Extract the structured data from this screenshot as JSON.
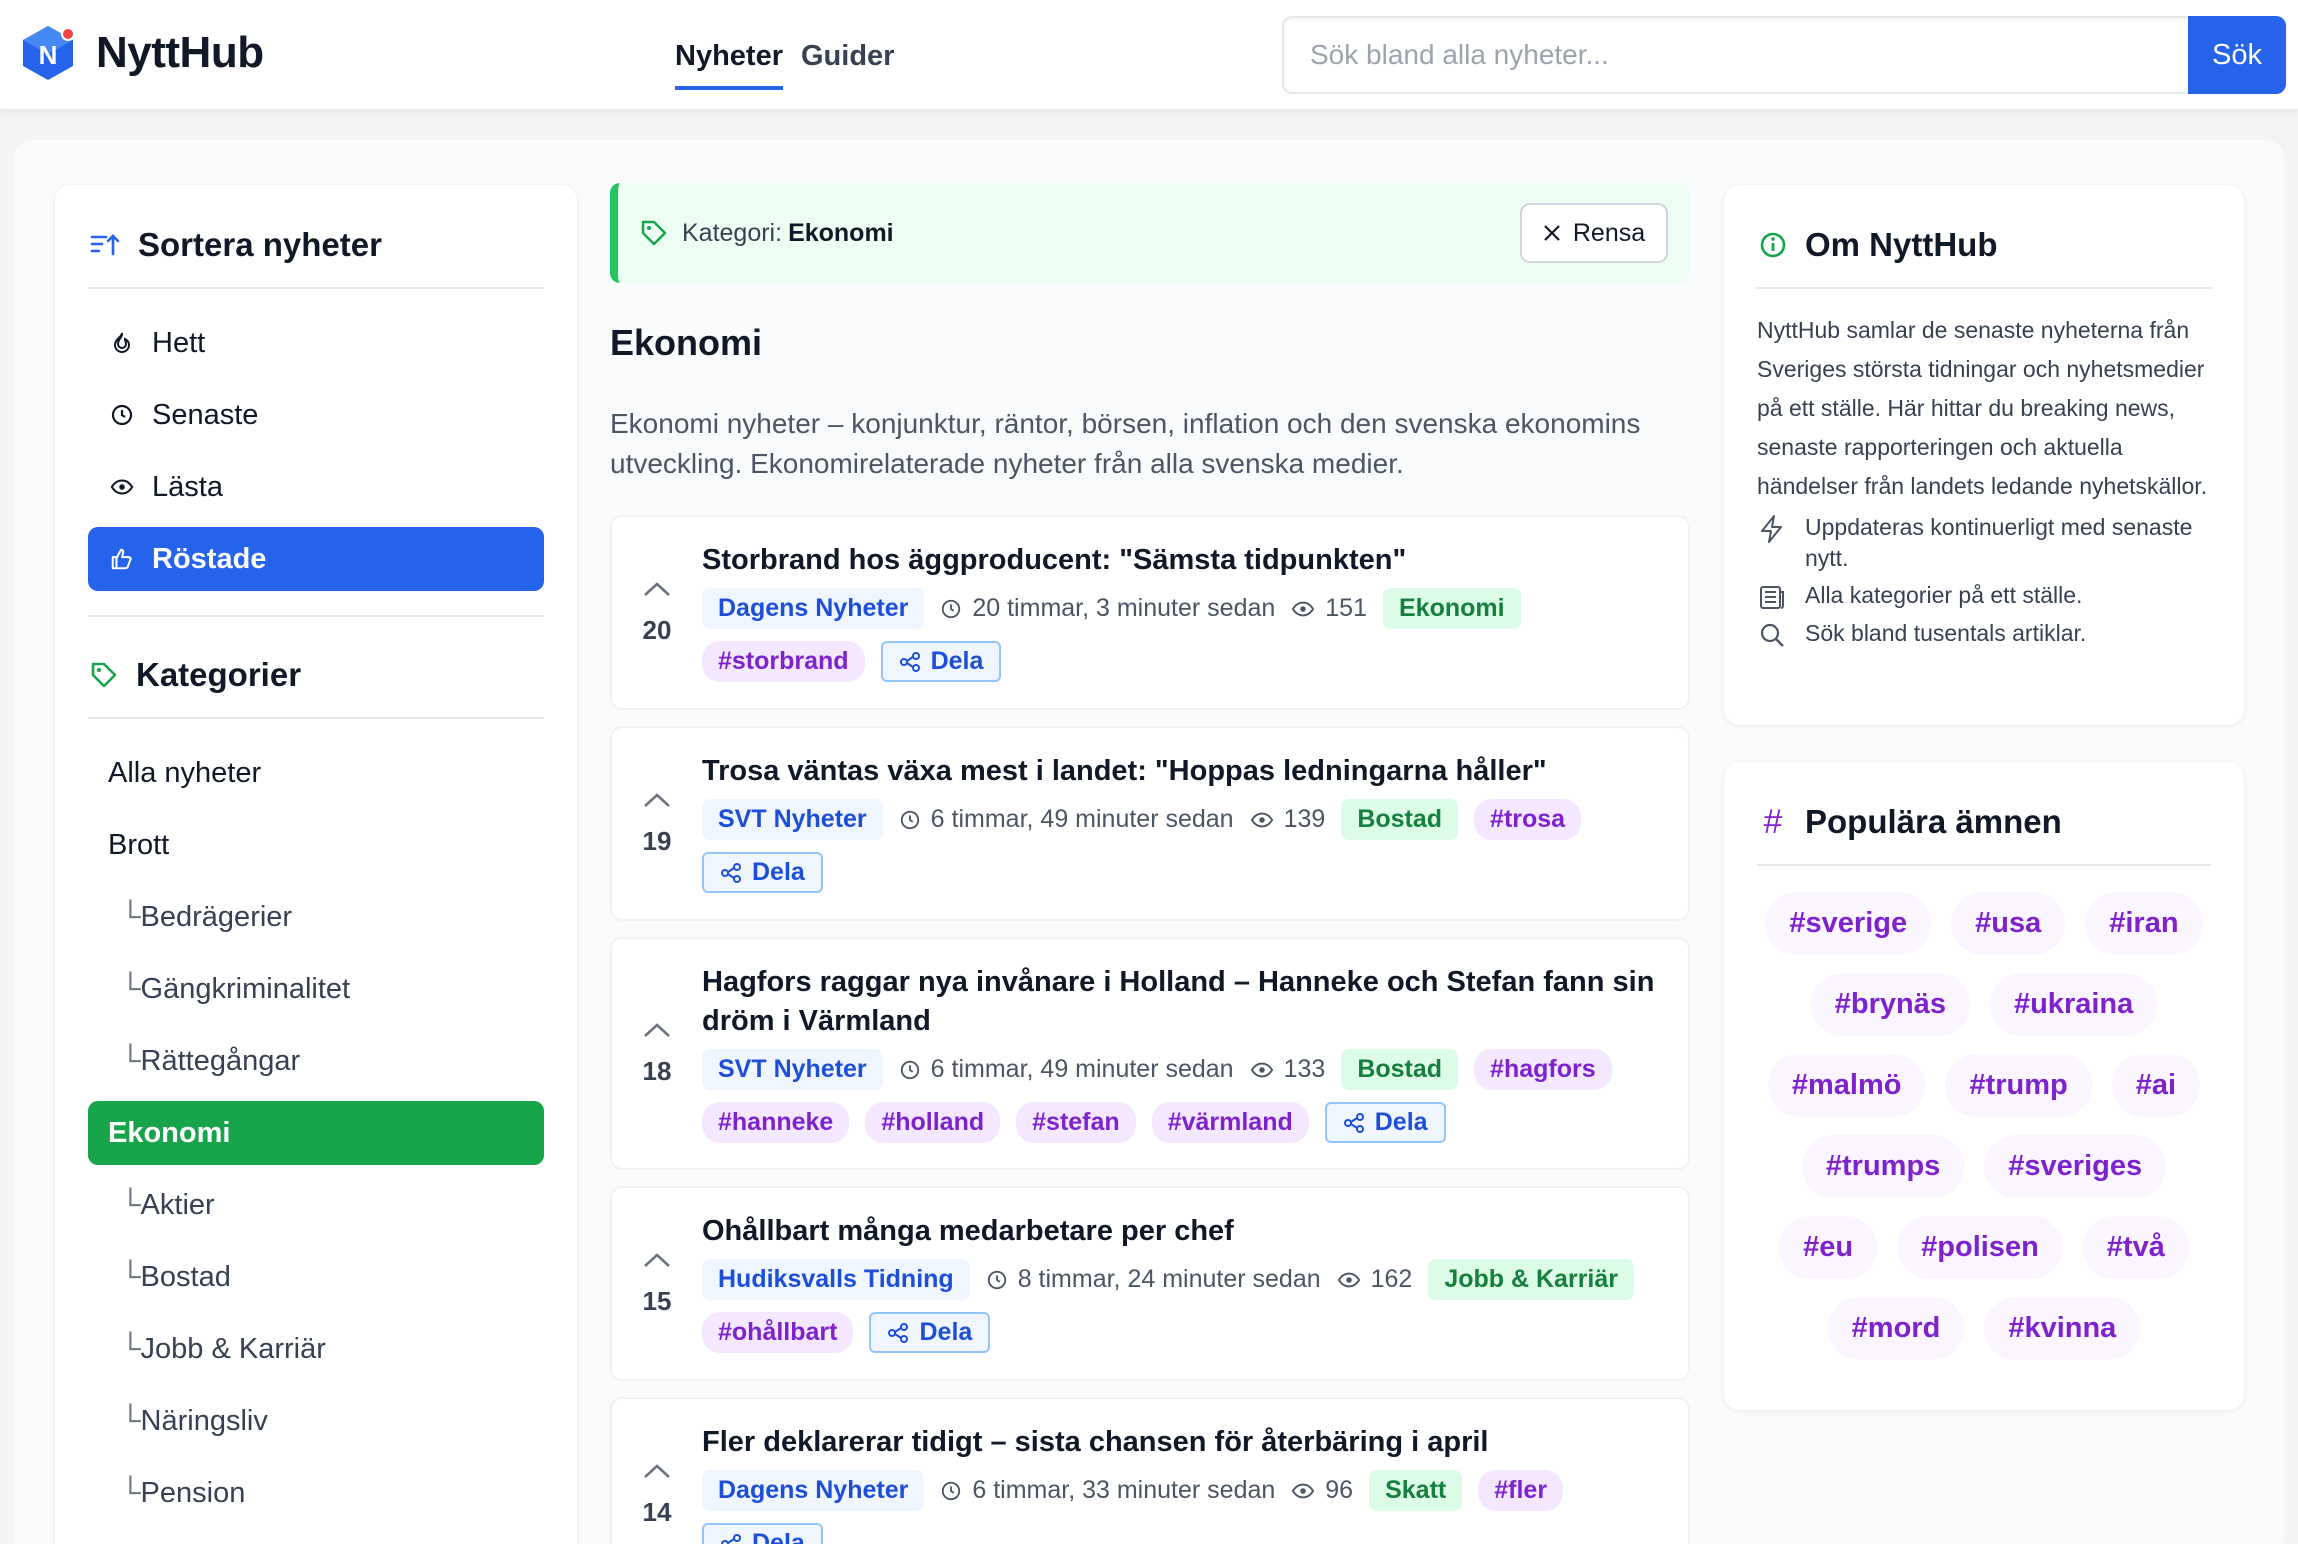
{
  "header": {
    "logo_text": "NyttHub",
    "nav": [
      {
        "label": "Nyheter",
        "active": true
      },
      {
        "label": "Guider",
        "active": false
      }
    ],
    "search_placeholder": "Sök bland alla nyheter...",
    "search_button": "Sök"
  },
  "sort": {
    "title": "Sortera nyheter",
    "items": [
      {
        "label": "Hett",
        "icon": "fire-icon"
      },
      {
        "label": "Senaste",
        "icon": "clock-icon"
      },
      {
        "label": "Lästa",
        "icon": "eye-icon"
      },
      {
        "label": "Röstade",
        "icon": "thumbs-up-icon",
        "active": true
      }
    ]
  },
  "categories": {
    "title": "Kategorier",
    "items": [
      {
        "label": "Alla nyheter"
      },
      {
        "label": "Brott"
      },
      {
        "label": "Bedrägerier",
        "sub": true
      },
      {
        "label": "Gängkriminalitet",
        "sub": true
      },
      {
        "label": "Rättegångar",
        "sub": true
      },
      {
        "label": "Ekonomi",
        "active": true
      },
      {
        "label": "Aktier",
        "sub": true
      },
      {
        "label": "Bostad",
        "sub": true
      },
      {
        "label": "Jobb & Karriär",
        "sub": true
      },
      {
        "label": "Näringsliv",
        "sub": true
      },
      {
        "label": "Pension",
        "sub": true
      }
    ]
  },
  "filter": {
    "label": "Kategori:",
    "value": "Ekonomi",
    "clear_label": "Rensa"
  },
  "category_heading": "Ekonomi",
  "category_description": "Ekonomi nyheter – konjunktur, räntor, börsen, inflation och den svenska ekonomins utveckling. Ekonomirelaterade nyheter från alla svenska medier.",
  "news": [
    {
      "votes": "20",
      "title": "Storbrand hos äggproducent: \"Sämsta tidpunkten\"",
      "source": "Dagens Nyheter",
      "time": "20 timmar, 3 minuter sedan",
      "views": "151",
      "category": "Ekonomi",
      "tags": [
        "#storbrand"
      ],
      "share": "Dela"
    },
    {
      "votes": "19",
      "title": "Trosa väntas växa mest i landet: \"Hoppas ledningarna håller\"",
      "source": "SVT Nyheter",
      "time": "6 timmar, 49 minuter sedan",
      "views": "139",
      "category": "Bostad",
      "tags": [
        "#trosa"
      ],
      "share": "Dela"
    },
    {
      "votes": "18",
      "title": "Hagfors raggar nya invånare i Holland – Hanneke och Stefan fann sin dröm i Värmland",
      "source": "SVT Nyheter",
      "time": "6 timmar, 49 minuter sedan",
      "views": "133",
      "category": "Bostad",
      "tags": [
        "#hagfors",
        "#hanneke",
        "#holland",
        "#stefan",
        "#värmland"
      ],
      "share": "Dela"
    },
    {
      "votes": "15",
      "title": "Ohållbart många medarbetare per chef",
      "source": "Hudiksvalls Tidning",
      "time": "8 timmar, 24 minuter sedan",
      "views": "162",
      "category": "Jobb & Karriär",
      "tags": [
        "#ohållbart"
      ],
      "share": "Dela"
    },
    {
      "votes": "14",
      "title": "Fler deklarerar tidigt – sista chansen för återbäring i april",
      "source": "Dagens Nyheter",
      "time": "6 timmar, 33 minuter sedan",
      "views": "96",
      "category": "Skatt",
      "tags": [
        "#fler"
      ],
      "share": "Dela"
    }
  ],
  "about": {
    "title": "Om NyttHub",
    "text": "NyttHub samlar de senaste nyheterna från Sveriges största tidningar och nyhetsmedier på ett ställe. Här hittar du breaking news, senaste rapporteringen och aktuella händelser från landets ledande nyhetskällor.",
    "features": [
      {
        "icon": "lightning-icon",
        "text": "Uppdateras kontinuerligt med senaste nytt."
      },
      {
        "icon": "newspaper-icon",
        "text": "Alla kategorier på ett ställe."
      },
      {
        "icon": "search-icon",
        "text": "Sök bland tusentals artiklar."
      }
    ]
  },
  "popular": {
    "title": "Populära ämnen",
    "tags": [
      "#sverige",
      "#usa",
      "#iran",
      "#brynäs",
      "#ukraina",
      "#malmö",
      "#trump",
      "#ai",
      "#trumps",
      "#sveriges",
      "#eu",
      "#polisen",
      "#två",
      "#mord",
      "#kvinna"
    ]
  },
  "colors": {
    "primary": "#2563eb",
    "green": "#16a34a",
    "purple": "#7e22ce"
  }
}
